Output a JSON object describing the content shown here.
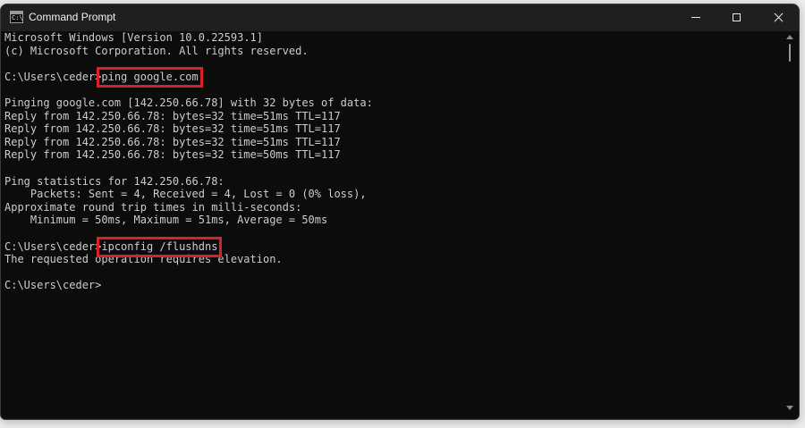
{
  "window": {
    "title": "Command Prompt",
    "icon": "cmd-icon",
    "icon_text": "C:\\"
  },
  "controls": {
    "minimize": "minimize-icon",
    "maximize": "maximize-icon",
    "close": "close-icon"
  },
  "console": {
    "lines": [
      "Microsoft Windows [Version 10.0.22593.1]",
      "(c) Microsoft Corporation. All rights reserved.",
      "",
      "",
      "",
      "Pinging google.com [142.250.66.78] with 32 bytes of data:",
      "Reply from 142.250.66.78: bytes=32 time=51ms TTL=117",
      "Reply from 142.250.66.78: bytes=32 time=51ms TTL=117",
      "Reply from 142.250.66.78: bytes=32 time=51ms TTL=117",
      "Reply from 142.250.66.78: bytes=32 time=50ms TTL=117",
      "",
      "Ping statistics for 142.250.66.78:",
      "    Packets: Sent = 4, Received = 4, Lost = 0 (0% loss),",
      "Approximate round trip times in milli-seconds:",
      "    Minimum = 50ms, Maximum = 51ms, Average = 50ms",
      "",
      "",
      "The requested operation requires elevation.",
      "",
      "C:\\Users\\ceder>"
    ],
    "prompt": "C:\\Users\\ceder>",
    "command1": "ping google.com",
    "command2": "ipconfig /flushdns"
  },
  "colors": {
    "background": "#0c0c0c",
    "text": "#cccccc",
    "titlebar": "#1f1f1f",
    "highlight": "#d7222a"
  }
}
